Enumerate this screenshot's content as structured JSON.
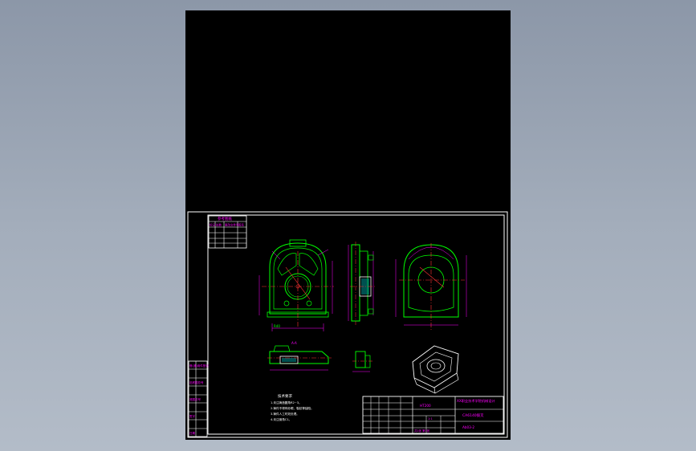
{
  "viewer": {
    "background_color": "#9aa5b4",
    "sheet_color": "#000000"
  },
  "drawing": {
    "revision_table": {
      "header_top": "参考图纸",
      "header_cells": [
        "标记",
        "处数",
        "更改文件号",
        "签名"
      ]
    },
    "left_strip": {
      "rows": [
        "借(通)用件登记",
        "",
        "旧底图总号",
        "",
        "底图总号",
        "",
        "签字",
        "",
        "日期"
      ]
    },
    "view_labels": {
      "front_dim": "R40",
      "section": "A-A"
    },
    "tech_requirements": {
      "title": "技术要求",
      "lines": [
        "1.未注铸造圆角R2~3。",
        "2.铸件不得有砂眼、裂纹等缺陷。",
        "3.铸件人工时效处理。",
        "4.未注倒角C1。"
      ]
    },
    "title_block": {
      "school": "XX职业技术学院机械设计",
      "part_name": "CA6140拨叉",
      "material": "HT200",
      "scale": "1:1",
      "sheet": "共1张 第1张",
      "drawing_no": "Ab03-2"
    },
    "colors": {
      "frame": "#ffffff",
      "geometry": "#00ff00",
      "dimension": "#ff00ff",
      "centerline": "#ff3333",
      "hatch": "#00ffff",
      "section_outline": "#ffffff"
    }
  }
}
